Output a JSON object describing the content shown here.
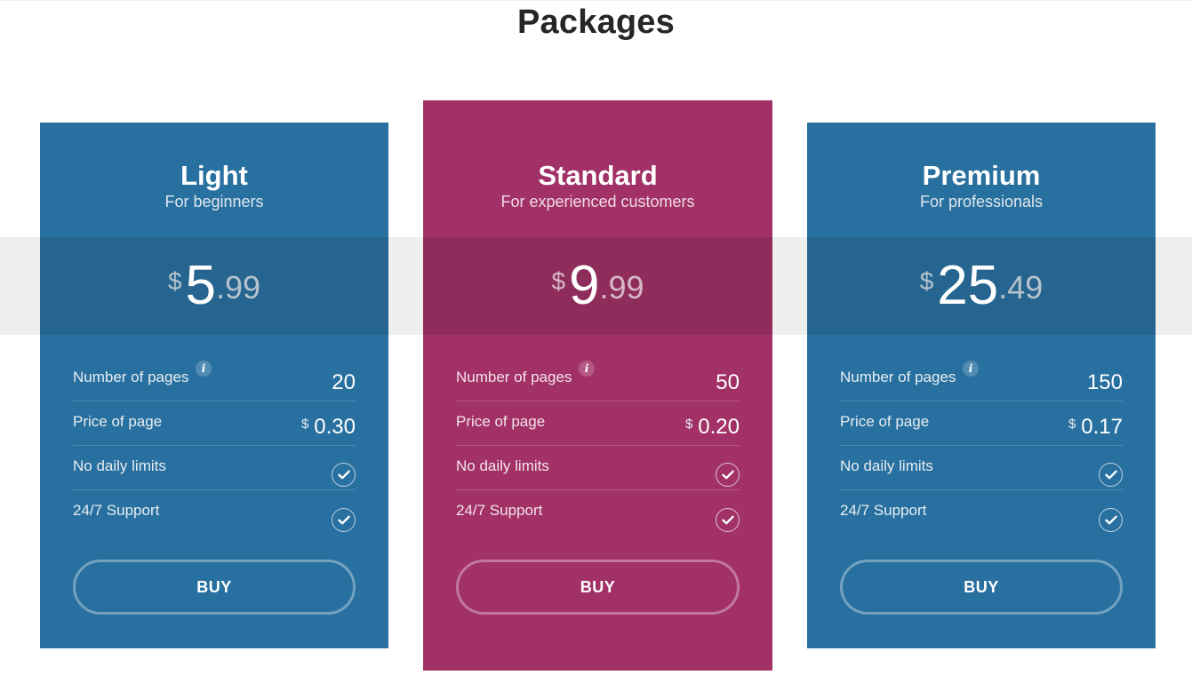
{
  "page": {
    "title": "Packages"
  },
  "colors": {
    "blue": "#28709f",
    "pink": "#a13166",
    "band": "#efefef"
  },
  "packages": [
    {
      "name": "Light",
      "subtitle": "For beginners",
      "price": {
        "currency": "$",
        "integer": "5",
        "decimal": ".99"
      },
      "features": {
        "pages_label": "Number of pages",
        "pages_value": "20",
        "info_icon": "i",
        "price_label": "Price of page",
        "price_currency": "$",
        "price_value": "0.30",
        "limits_label": "No daily limits",
        "support_label": "24/7 Support"
      },
      "buy_label": "BUY"
    },
    {
      "name": "Standard",
      "subtitle": "For experienced customers",
      "price": {
        "currency": "$",
        "integer": "9",
        "decimal": ".99"
      },
      "features": {
        "pages_label": "Number of pages",
        "pages_value": "50",
        "info_icon": "i",
        "price_label": "Price of page",
        "price_currency": "$",
        "price_value": "0.20",
        "limits_label": "No daily limits",
        "support_label": "24/7 Support"
      },
      "buy_label": "BUY"
    },
    {
      "name": "Premium",
      "subtitle": "For professionals",
      "price": {
        "currency": "$",
        "integer": "25",
        "decimal": ".49"
      },
      "features": {
        "pages_label": "Number of pages",
        "pages_value": "150",
        "info_icon": "i",
        "price_label": "Price of page",
        "price_currency": "$",
        "price_value": "0.17",
        "limits_label": "No daily limits",
        "support_label": "24/7 Support"
      },
      "buy_label": "BUY"
    }
  ]
}
